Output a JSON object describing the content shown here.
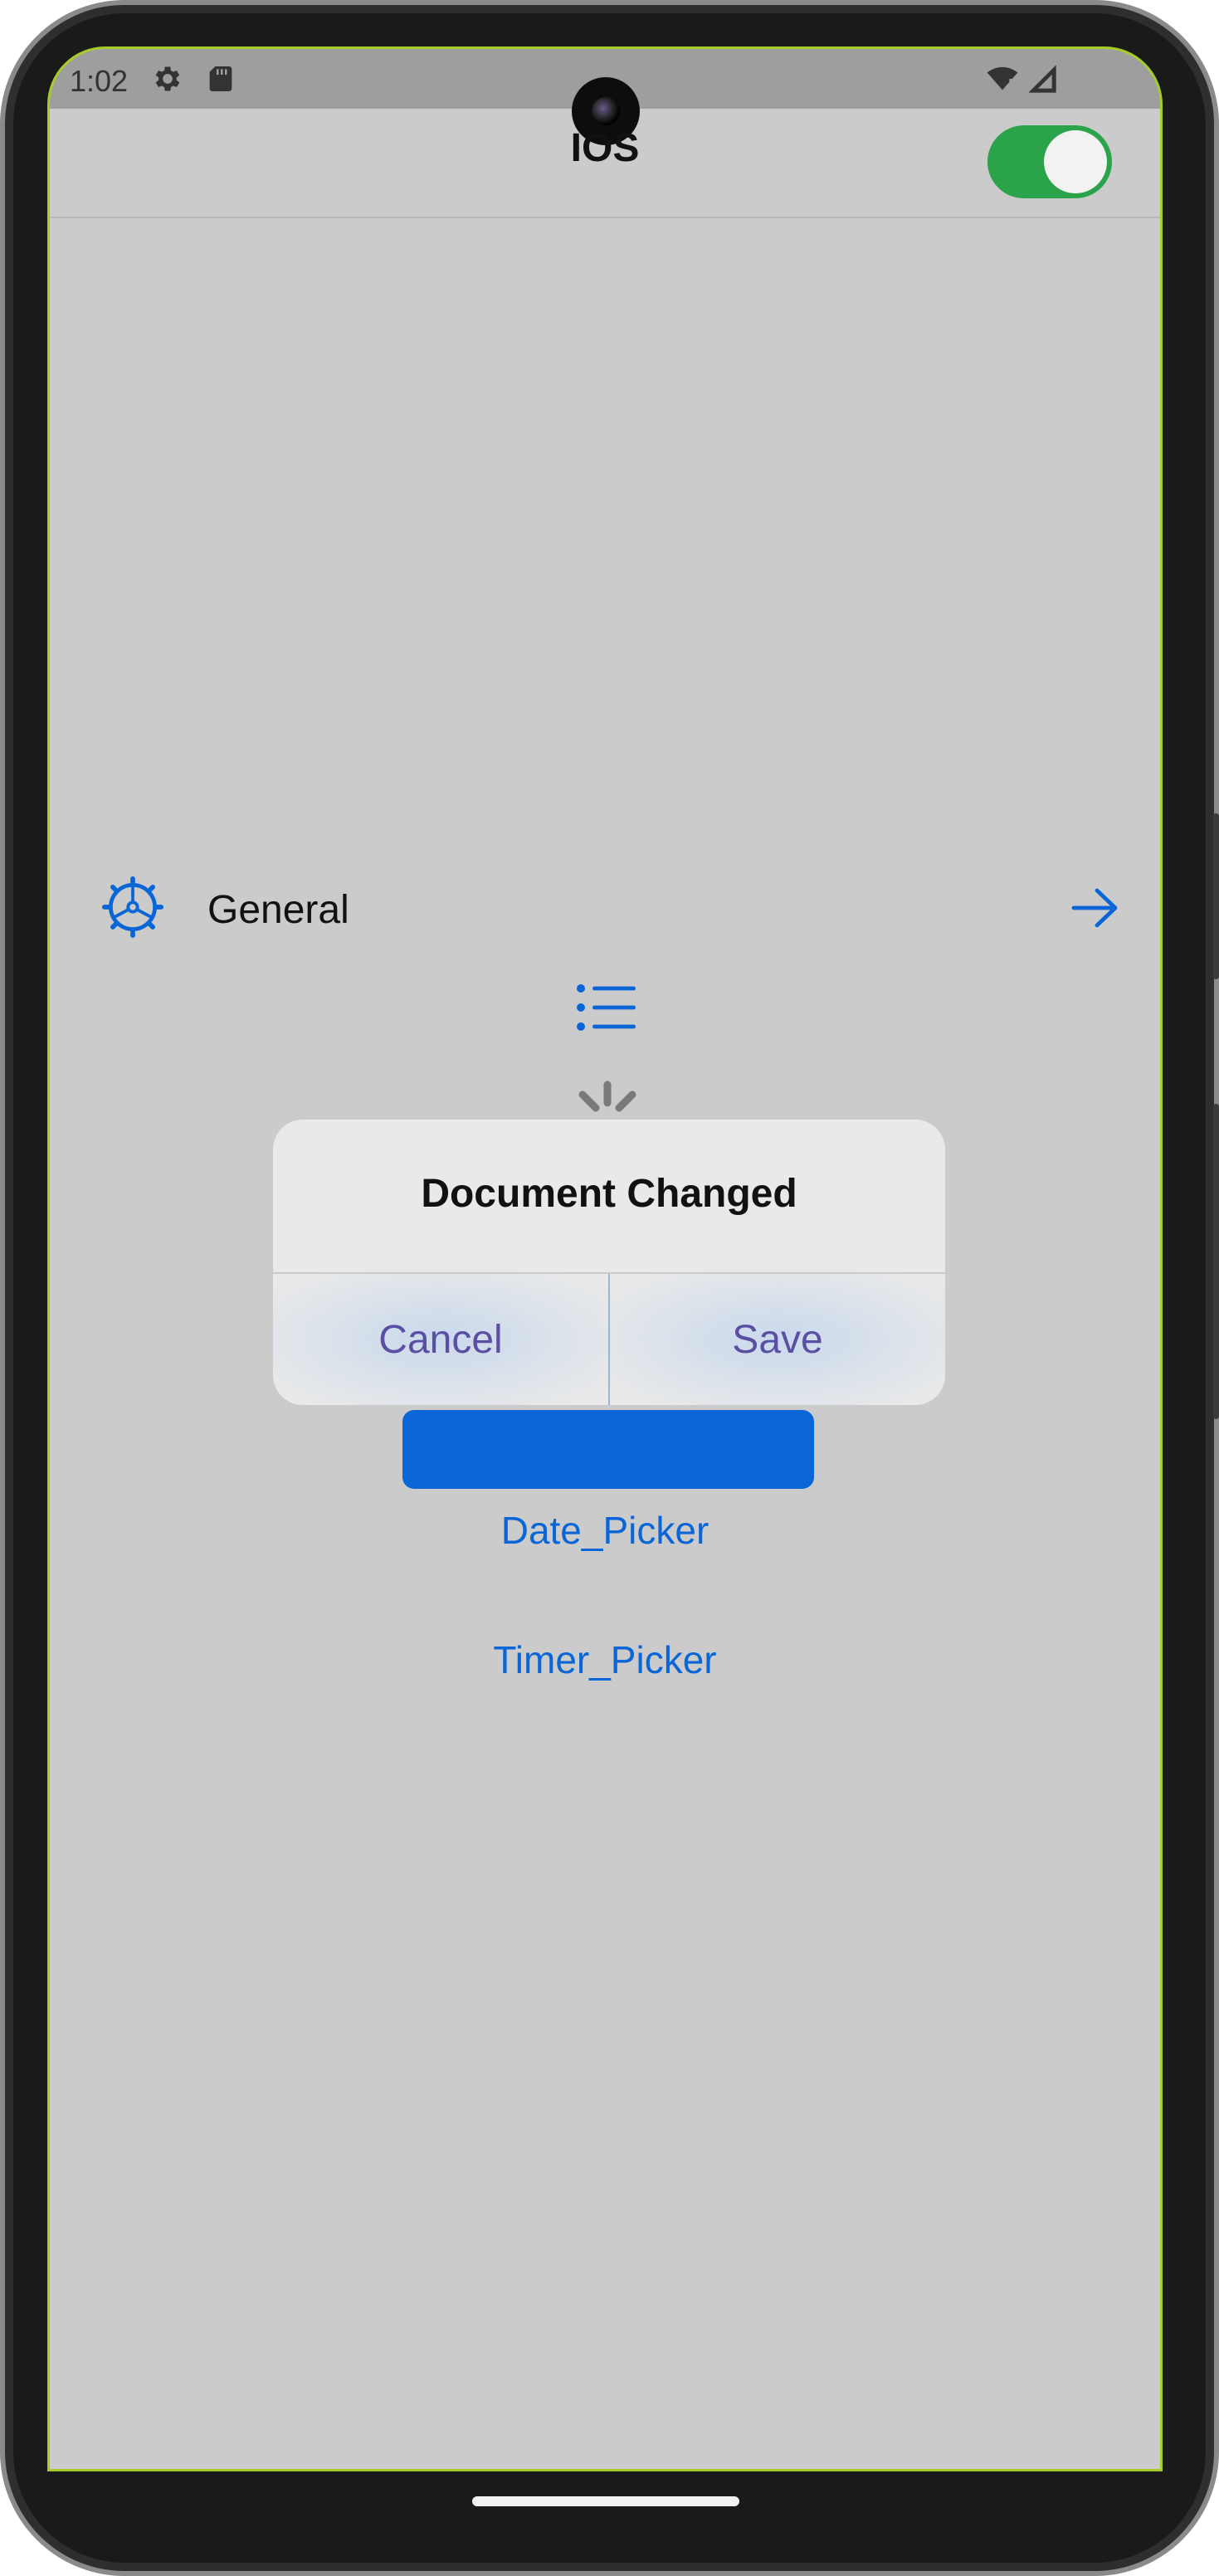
{
  "status_bar": {
    "time": "1:02",
    "icons": [
      "gear-icon",
      "sd-card-icon",
      "wifi-icon",
      "signal-icon"
    ]
  },
  "app_bar": {
    "title": "IOS",
    "toggle_on": true,
    "toggle_color": "#2aa34a"
  },
  "list": {
    "general_label": "General",
    "general_icon": "gear-icon",
    "arrow_icon": "arrow-right-icon"
  },
  "menu_icon": "list-icon",
  "spinner_icon": "activity-indicator-icon",
  "links": {
    "date_picker": "Date_Picker",
    "timer_picker": "Timer_Picker"
  },
  "dialog": {
    "title": "Document Changed",
    "cancel_label": "Cancel",
    "save_label": "Save"
  },
  "colors": {
    "accent": "#0a66d6",
    "dialog_button_text": "#5b4fa3",
    "background": "#cbcbcb"
  }
}
